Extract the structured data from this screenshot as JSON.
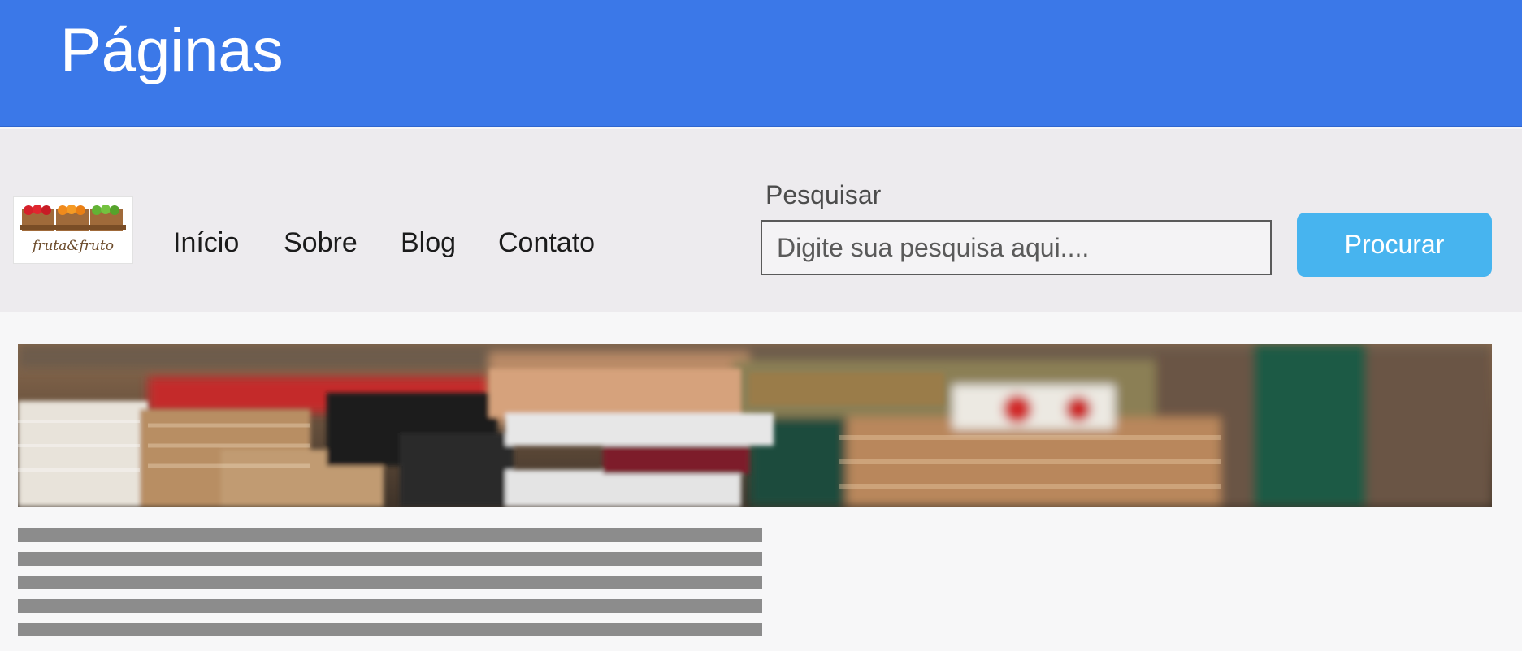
{
  "header": {
    "title": "Páginas"
  },
  "navbar": {
    "logo": {
      "text": "fruta&fruto",
      "icon": "fruit-crates-logo"
    },
    "links": [
      {
        "label": "Início"
      },
      {
        "label": "Sobre"
      },
      {
        "label": "Blog"
      },
      {
        "label": "Contato"
      }
    ],
    "search": {
      "label": "Pesquisar",
      "placeholder": "Digite sua pesquisa aqui....",
      "value": "",
      "button_label": "Procurar"
    }
  },
  "hero": {
    "image": "market-produce-crates-photo"
  },
  "content": {
    "placeholder_lines": 5
  },
  "colors": {
    "header_bg": "#3b78e8",
    "navbar_bg": "#edebee",
    "button_bg": "#47b4ef",
    "placeholder_line": "#8c8c8c"
  }
}
